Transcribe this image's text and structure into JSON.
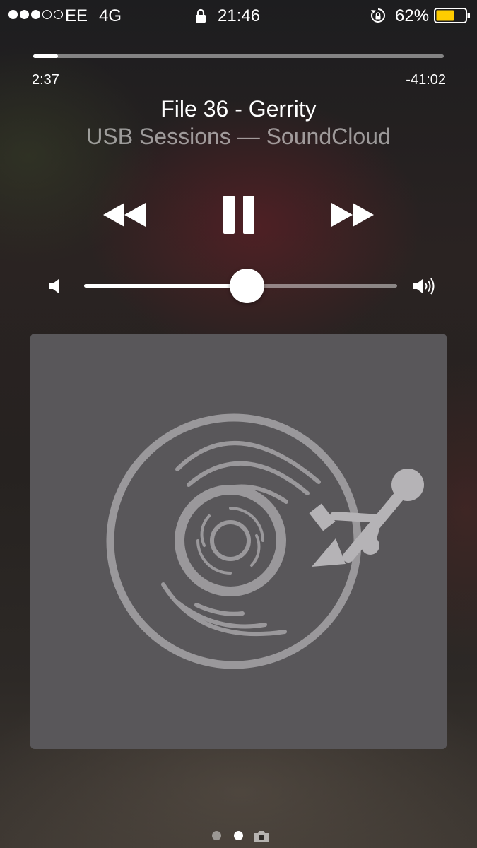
{
  "status_bar": {
    "signal_bars_filled": 3,
    "signal_bars_total": 5,
    "carrier": "EE",
    "network": "4G",
    "lock_icon": "lock-icon",
    "time": "21:46",
    "rotation_lock_icon": "rotation-lock-icon",
    "battery_percent": "62%",
    "battery_level": 0.62,
    "battery_color": "#ffcc00"
  },
  "now_playing": {
    "elapsed": "2:37",
    "remaining": "-41:02",
    "progress": 0.06,
    "title": "File 36 - Gerrity",
    "subtitle": "USB Sessions — SoundCloud"
  },
  "controls": {
    "rewind_icon": "rewind-icon",
    "pause_icon": "pause-icon",
    "forward_icon": "fast-forward-icon"
  },
  "volume": {
    "level": 0.52,
    "low_icon": "volume-low-icon",
    "high_icon": "volume-high-icon"
  },
  "artwork": {
    "icon": "vinyl-record-usb-icon",
    "background": "#59575a",
    "foreground": "#9a989b"
  },
  "page_indicator": {
    "pages": 2,
    "current": 2,
    "camera_icon": "camera-icon"
  }
}
